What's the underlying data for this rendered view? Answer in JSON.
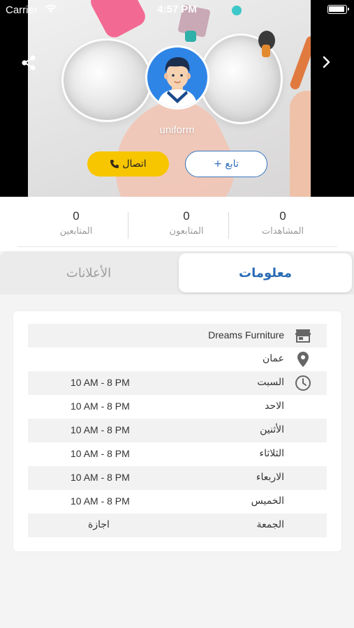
{
  "status_bar": {
    "carrier": "Carrier",
    "time": "4:57 PM"
  },
  "profile": {
    "username": "uniform",
    "call_label": "اتصال",
    "follow_label": "+ تابع"
  },
  "stats": [
    {
      "value": "0",
      "label": "المشاهدات"
    },
    {
      "value": "0",
      "label": "المتابعون"
    },
    {
      "value": "0",
      "label": "المتابعين"
    }
  ],
  "tabs": {
    "info": "معلومات",
    "ads": "الأعلانات"
  },
  "info": {
    "store_name": "Dreams Furniture",
    "location": "عمان",
    "schedule": [
      {
        "day": "السبت",
        "hours": "10 AM - 8 PM"
      },
      {
        "day": "الاحد",
        "hours": "10 AM - 8 PM"
      },
      {
        "day": "الأثنين",
        "hours": "10 AM - 8 PM"
      },
      {
        "day": "الثلاثاء",
        "hours": "10 AM - 8 PM"
      },
      {
        "day": "الاربعاء",
        "hours": "10 AM - 8 PM"
      },
      {
        "day": "الخميس",
        "hours": "10 AM - 8 PM"
      },
      {
        "day": "الجمعة",
        "hours": "اجازة"
      }
    ]
  },
  "colors": {
    "accent_blue": "#2a6bb3",
    "call_yellow": "#f7c600",
    "avatar_blue": "#2f85e6"
  },
  "icons": {
    "share": "share-icon",
    "next": "chevron-right-icon",
    "store": "store-icon",
    "location": "location-pin-icon",
    "hours": "clock-icon",
    "phone": "phone-icon"
  }
}
